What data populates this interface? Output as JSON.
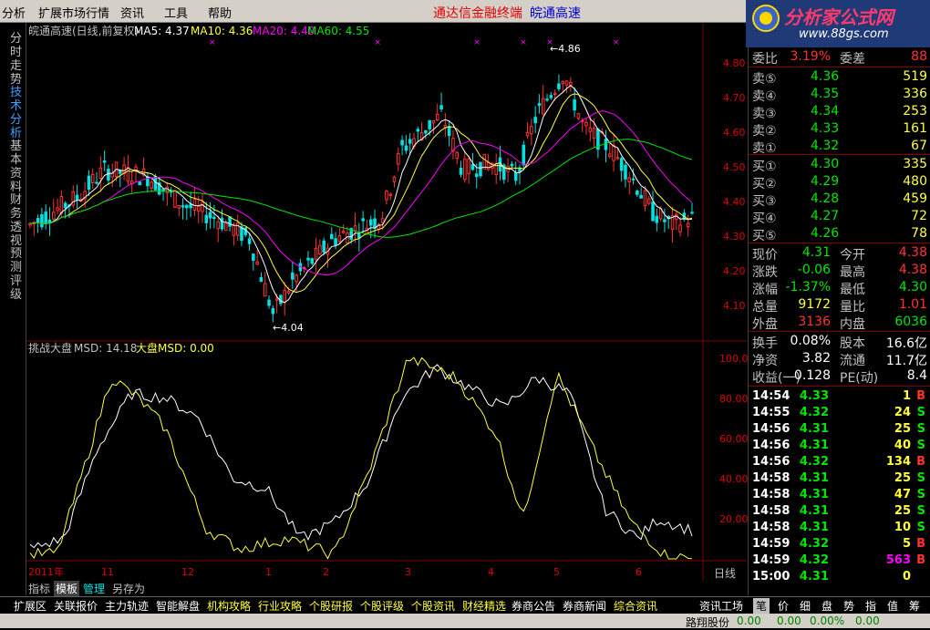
{
  "menu": {
    "items": [
      "分析",
      "扩展市场行情",
      "资讯",
      "工具",
      "帮助"
    ],
    "promo_red": "通达信金融终端",
    "promo_blue": "皖通高速"
  },
  "logo": {
    "title": "分析家公式网",
    "url": "www.88gs.com"
  },
  "left_tabs": [
    {
      "label": "分时走势",
      "active": false
    },
    {
      "label": "技术分析",
      "active": true
    },
    {
      "label": "基本资料",
      "active": false
    },
    {
      "label": "财务透视",
      "active": false
    },
    {
      "label": "预测评级",
      "active": false
    }
  ],
  "main_chart": {
    "header_title": "皖通高速(日线,前复权)",
    "ma5_label": "MA5: 4.37",
    "ma10_label": "MA10: 4.36",
    "ma20_label": "MA20: 4.40",
    "ma60_label": "MA60: 4.55",
    "high_mark": "4.86",
    "low_mark": "4.04",
    "price_ticks": [
      "4.80",
      "4.70",
      "4.60",
      "4.50",
      "4.40",
      "4.30",
      "4.20",
      "4.10"
    ],
    "colors": {
      "up": "#ff3232",
      "down": "#00e1e1",
      "ma5": "#ffffff",
      "ma10": "#ffff3c",
      "ma20": "#ff00ff",
      "ma60": "#00e600"
    }
  },
  "indicator": {
    "name": "挑战大盘",
    "msd_label": "MSD: 14.18",
    "market_msd_label": "大盘MSD: 0.00",
    "ticks": [
      "100.0",
      "80.00",
      "60.00",
      "40.00",
      "20.00"
    ]
  },
  "x_axis": {
    "labels": [
      "2011年",
      "11",
      "12",
      "1",
      "2",
      "3",
      "4",
      "5",
      "6"
    ],
    "period": "日线"
  },
  "chart_data": [
    {
      "type": "candlestick",
      "title": "皖通高速(日线,前复权)",
      "ylim": [
        4.04,
        4.86
      ],
      "annotations": [
        {
          "label": "4.86"
        },
        {
          "label": "4.04"
        }
      ],
      "series": [
        {
          "name": "MA5",
          "last": 4.37
        },
        {
          "name": "MA10",
          "last": 4.36
        },
        {
          "name": "MA20",
          "last": 4.4
        },
        {
          "name": "MA60",
          "last": 4.55
        }
      ]
    },
    {
      "type": "line",
      "title": "挑战大盘",
      "ylim": [
        0,
        100
      ],
      "series": [
        {
          "name": "MSD",
          "last": 14.18
        },
        {
          "name": "大盘MSD",
          "last": 0.0
        }
      ]
    }
  ],
  "quote": {
    "ratio": {
      "label": "委比",
      "value": "3.19%",
      "label2": "委差",
      "value2": "88"
    },
    "asks": [
      {
        "label": "卖⑤",
        "price": "4.36",
        "vol": "519"
      },
      {
        "label": "卖④",
        "price": "4.35",
        "vol": "336"
      },
      {
        "label": "卖③",
        "price": "4.34",
        "vol": "253"
      },
      {
        "label": "卖②",
        "price": "4.33",
        "vol": "161"
      },
      {
        "label": "卖①",
        "price": "4.32",
        "vol": "67"
      }
    ],
    "bids": [
      {
        "label": "买①",
        "price": "4.30",
        "vol": "335"
      },
      {
        "label": "买②",
        "price": "4.29",
        "vol": "480"
      },
      {
        "label": "买③",
        "price": "4.28",
        "vol": "459"
      },
      {
        "label": "买④",
        "price": "4.27",
        "vol": "72"
      },
      {
        "label": "买⑤",
        "price": "4.26",
        "vol": "78"
      }
    ],
    "stats": [
      {
        "l1": "现价",
        "v1": "4.31",
        "c1": "green",
        "l2": "今开",
        "v2": "4.38",
        "c2": "red"
      },
      {
        "l1": "涨跌",
        "v1": "-0.06",
        "c1": "green",
        "l2": "最高",
        "v2": "4.38",
        "c2": "red"
      },
      {
        "l1": "涨幅",
        "v1": "-1.37%",
        "c1": "green",
        "l2": "最低",
        "v2": "4.30",
        "c2": "green"
      },
      {
        "l1": "总量",
        "v1": "9172",
        "c1": "yellow",
        "l2": "量比",
        "v2": "1.01",
        "c2": "red"
      },
      {
        "l1": "外盘",
        "v1": "3136",
        "c1": "red",
        "l2": "内盘",
        "v2": "6036",
        "c2": "green"
      }
    ],
    "fundamentals": [
      {
        "l1": "换手",
        "v1": "0.08%",
        "l2": "股本",
        "v2": "16.6亿"
      },
      {
        "l1": "净资",
        "v1": "3.82",
        "l2": "流通",
        "v2": "11.7亿"
      },
      {
        "l1": "收益(一)",
        "v1": "0.128",
        "l2": "PE(动)",
        "v2": "8.4"
      }
    ],
    "ticks": [
      {
        "time": "14:54",
        "price": "4.33",
        "pc": "green",
        "vol": "1",
        "vc": "yellow",
        "side": "B",
        "sc": "red"
      },
      {
        "time": "14:55",
        "price": "4.32",
        "pc": "green",
        "vol": "24",
        "vc": "yellow",
        "side": "S",
        "sc": "green"
      },
      {
        "time": "14:56",
        "price": "4.31",
        "pc": "green",
        "vol": "25",
        "vc": "yellow",
        "side": "S",
        "sc": "green"
      },
      {
        "time": "14:56",
        "price": "4.31",
        "pc": "green",
        "vol": "40",
        "vc": "yellow",
        "side": "S",
        "sc": "green"
      },
      {
        "time": "14:56",
        "price": "4.32",
        "pc": "green",
        "vol": "134",
        "vc": "yellow",
        "side": "B",
        "sc": "red"
      },
      {
        "time": "14:58",
        "price": "4.31",
        "pc": "green",
        "vol": "25",
        "vc": "yellow",
        "side": "S",
        "sc": "green"
      },
      {
        "time": "14:58",
        "price": "4.31",
        "pc": "green",
        "vol": "47",
        "vc": "yellow",
        "side": "S",
        "sc": "green"
      },
      {
        "time": "14:58",
        "price": "4.31",
        "pc": "green",
        "vol": "25",
        "vc": "yellow",
        "side": "S",
        "sc": "green"
      },
      {
        "time": "14:58",
        "price": "4.31",
        "pc": "green",
        "vol": "10",
        "vc": "yellow",
        "side": "S",
        "sc": "green"
      },
      {
        "time": "14:59",
        "price": "4.32",
        "pc": "green",
        "vol": "5",
        "vc": "yellow",
        "side": "B",
        "sc": "red"
      },
      {
        "time": "14:59",
        "price": "4.32",
        "pc": "green",
        "vol": "563",
        "vc": "magenta",
        "side": "B",
        "sc": "red"
      },
      {
        "time": "15:00",
        "price": "4.31",
        "pc": "green",
        "vol": "0",
        "vc": "yellow",
        "side": "",
        "sc": "red"
      }
    ]
  },
  "chart_toolbar": [
    "指标",
    "模板",
    "管理",
    "另存为"
  ],
  "bottom_tabs": [
    {
      "label": "扩展区",
      "c": "w"
    },
    {
      "label": "关联报价",
      "c": "w"
    },
    {
      "label": "主力轨迹",
      "c": "w"
    },
    {
      "label": "智能解盘",
      "c": "w"
    },
    {
      "label": "机构攻略",
      "c": "y"
    },
    {
      "label": "行业攻略",
      "c": "y"
    },
    {
      "label": "个股研报",
      "c": "y"
    },
    {
      "label": "个股评级",
      "c": "y"
    },
    {
      "label": "个股资讯",
      "c": "y"
    },
    {
      "label": "财经精选",
      "c": "y"
    },
    {
      "label": "券商公告",
      "c": "w"
    },
    {
      "label": "券商新闻",
      "c": "w"
    },
    {
      "label": "综合资讯",
      "c": "y"
    },
    {
      "label": "资讯工场",
      "c": "w"
    }
  ],
  "right_tabs": [
    "笔",
    "价",
    "细",
    "盘",
    "势",
    "指",
    "值",
    "筹"
  ],
  "status": {
    "name": "路翔股份",
    "v1": "0.00",
    "v2": "0.00",
    "v3": "0.00%",
    "v4": "0.00"
  }
}
